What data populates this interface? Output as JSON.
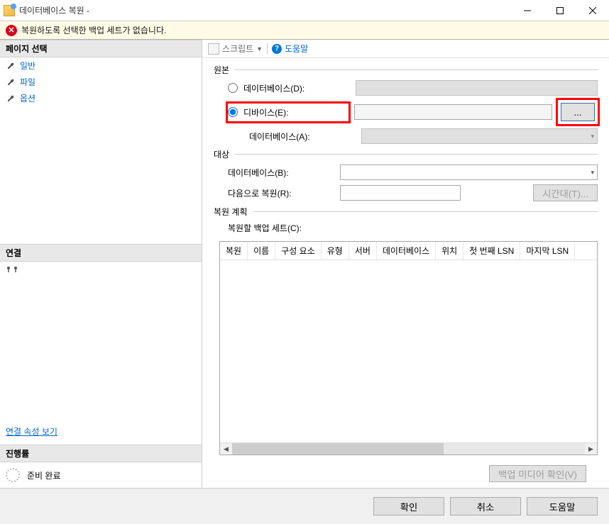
{
  "titlebar": {
    "title": "데이터베이스 복원 -"
  },
  "error_banner": {
    "text": "복원하도록 선택한 백업 세트가 없습니다."
  },
  "sidebar": {
    "page_select_header": "페이지 선택",
    "items": [
      {
        "label": "일반"
      },
      {
        "label": "파일"
      },
      {
        "label": "옵션"
      }
    ],
    "connection_header": "연결",
    "view_properties": "연결 속성 보기",
    "progress_header": "진행률",
    "progress_status": "준비 완료"
  },
  "toolbar": {
    "script_label": "스크립트",
    "help_label": "도움말"
  },
  "form": {
    "source_group": "원본",
    "database_radio": "데이터베이스(D):",
    "device_radio": "디바이스(E):",
    "database_a_label": "데이터베이스(A):",
    "browse_label": "...",
    "target_group": "대상",
    "database_b_label": "데이터베이스(B):",
    "restore_to_label": "다음으로 복원(R):",
    "timeline_btn": "시간대(T)...",
    "plan_group": "복원 계획",
    "backup_sets_label": "복원할 백업 세트(C):",
    "columns": [
      "복원",
      "이름",
      "구성 요소",
      "유형",
      "서버",
      "데이터베이스",
      "위치",
      "첫 번째 LSN",
      "마지막 LSN"
    ],
    "verify_btn": "백업 미디어 확인(V)"
  },
  "footer": {
    "ok": "확인",
    "cancel": "취소",
    "help": "도움말"
  }
}
